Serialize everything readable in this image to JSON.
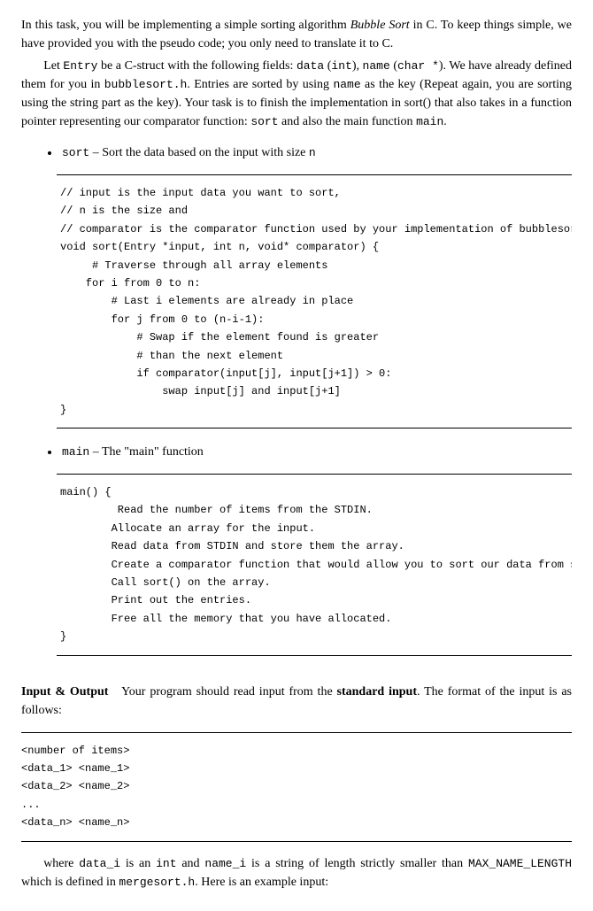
{
  "intro": {
    "p1": "In this task, you will be implementing a simple sorting algorithm ",
    "p1b": "Bubble Sort",
    "p1c": " in C. To keep things simple, we have provided you with the pseudo code; you only need to translate it to C.",
    "p2a": "Let ",
    "p2b": "Entry",
    "p2c": " be a C-struct with the following fields: ",
    "p2d": "data",
    "p2e": " (",
    "p2f": "int",
    "p2g": "), ",
    "p2h": "name",
    "p2i": " (",
    "p2j": "char *",
    "p2k": "). We have already defined them for you in ",
    "p2l": "bubblesort.h",
    "p2m": ". Entries are sorted by using ",
    "p2n": "name",
    "p2o": " as the key (Repeat again, you are sorting using the string part as the key). Your task is to finish the implementation in sort() that also takes in a function pointer representing our comparator function: ",
    "p2p": "sort",
    "p2q": " and also the main function ",
    "p2r": "main",
    "p2s": "."
  },
  "items": {
    "sort_name": "sort",
    "sort_desc": " – Sort the data based on the input with size ",
    "sort_n": "n",
    "main_name": "main",
    "main_desc": " – The \"main\" function"
  },
  "code_sort": "// input is the input data you want to sort,\n// n is the size and\n// comparator is the comparator function used by your implementation of bubblesort\nvoid sort(Entry *input, int n, void* comparator) {\n     # Traverse through all array elements\n    for i from 0 to n:\n        # Last i elements are already in place\n        for j from 0 to (n-i-1):\n            # Swap if the element found is greater\n            # than the next element\n            if comparator(input[j], input[j+1]) > 0:\n                swap input[j] and input[j+1]\n}",
  "code_main": "main() {\n         Read the number of items from the STDIN.\n        Allocate an array for the input.\n        Read data from STDIN and store them the array.\n        Create a comparator function that would allow you to sort our data from smallest to largest\n        Call sort() on the array.\n        Print out the entries.\n        Free all the memory that you have allocated.\n}",
  "io": {
    "head": "Input & Output",
    "text": "Your program should read input from the ",
    "std": "standard input",
    "text2": ". The format of the input is as follows:"
  },
  "format_block": "<number of items>\n<data_1> <name_1>\n<data_2> <name_2>\n...\n<data_n> <name_n>",
  "closing": {
    "a": "where ",
    "b": "data_i",
    "c": " is an ",
    "d": "int",
    "e": " and ",
    "f": "name_i",
    "g": " is a string of length strictly smaller than ",
    "h": "MAX_NAME_LENGTH",
    "i": " which is defined in ",
    "j": "mergesort.h",
    "k": ". Here is an example input:"
  }
}
